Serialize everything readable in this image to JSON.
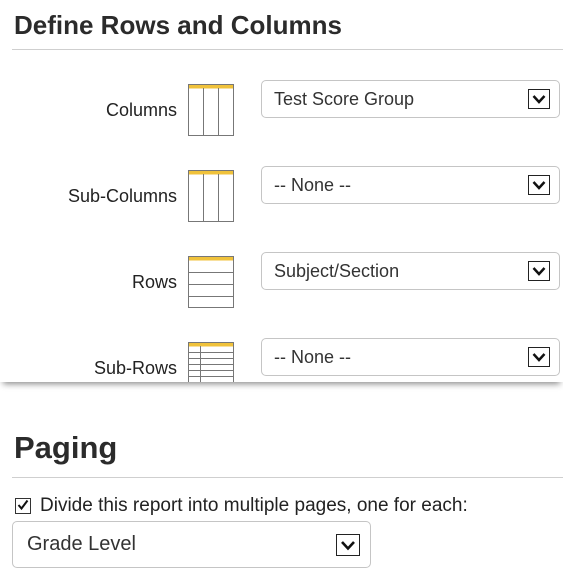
{
  "define_section": {
    "title": "Define Rows and Columns",
    "rows": [
      {
        "label": "Columns",
        "icon": "columns-grid-icon",
        "selected": "Test Score Group"
      },
      {
        "label": "Sub-Columns",
        "icon": "sub-columns-grid-icon",
        "selected": "-- None --"
      },
      {
        "label": "Rows",
        "icon": "rows-grid-icon",
        "selected": "Subject/Section"
      },
      {
        "label": "Sub-Rows",
        "icon": "sub-rows-grid-icon",
        "selected": "-- None --"
      }
    ]
  },
  "paging_section": {
    "title": "Paging",
    "checkbox_label": "Divide this report into multiple pages, one for each:",
    "checkbox_checked": true,
    "selected": "Grade Level"
  },
  "colors": {
    "accent_yellow": "#f0c23b",
    "icon_line": "#777777",
    "rule": "#cfcfcf"
  }
}
